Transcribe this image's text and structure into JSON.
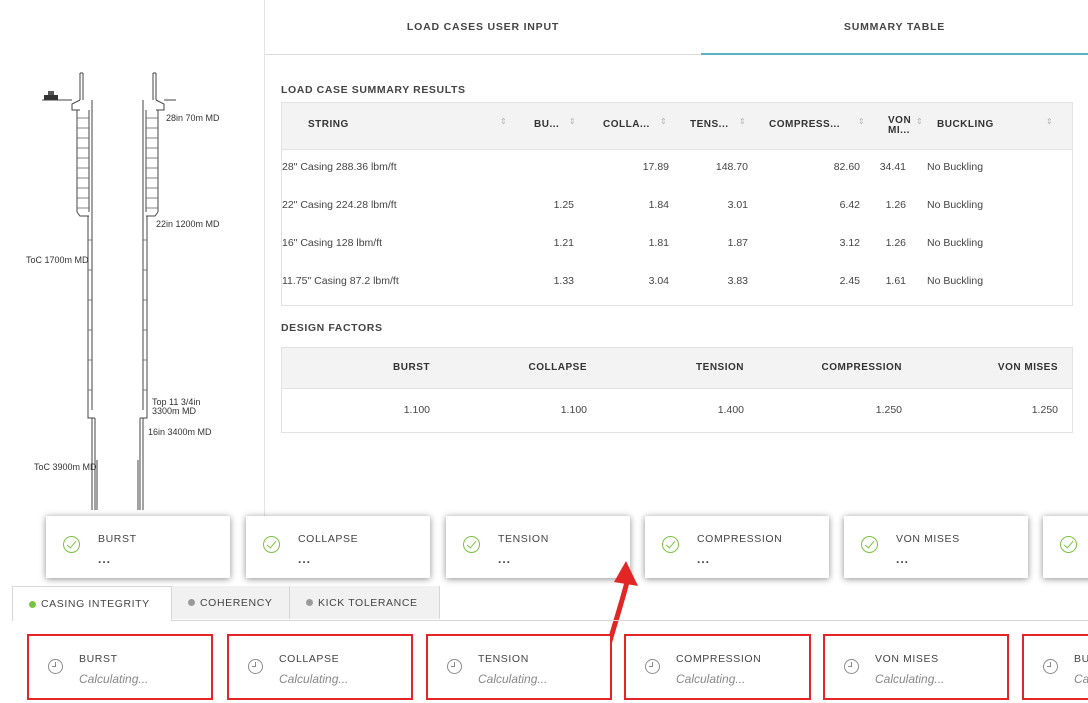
{
  "top_tabs": [
    "LOAD CASES USER INPUT",
    "SUMMARY TABLE"
  ],
  "wellbore": {
    "labels": {
      "l28": "28in 70m MD",
      "l22": "22in 1200m MD",
      "toc1": "ToC 1700m MD",
      "top1134": "Top 11 3/4in 3300m MD",
      "l16": "16in 3400m MD",
      "toc2": "ToC 3900m MD"
    }
  },
  "summary": {
    "title": "LOAD CASE SUMMARY RESULTS",
    "columns": [
      "STRING",
      "BU...",
      "COLLA...",
      "TENS...",
      "COMPRESS...",
      "VON MI...",
      "BUCKLING"
    ],
    "rows": [
      [
        "28\" Casing 288.36 lbm/ft",
        "",
        "17.89",
        "148.70",
        "82.60",
        "34.41",
        "No Buckling"
      ],
      [
        "22\" Casing 224.28 lbm/ft",
        "1.25",
        "1.84",
        "3.01",
        "6.42",
        "1.26",
        "No Buckling"
      ],
      [
        "16\" Casing 128 lbm/ft",
        "1.21",
        "1.81",
        "1.87",
        "3.12",
        "1.26",
        "No Buckling"
      ],
      [
        "11.75\" Casing 87.2 lbm/ft",
        "1.33",
        "3.04",
        "3.83",
        "2.45",
        "1.61",
        "No Buckling"
      ]
    ]
  },
  "design_factors": {
    "title": "DESIGN FACTORS",
    "columns": [
      "BURST",
      "COLLAPSE",
      "TENSION",
      "COMPRESSION",
      "VON MISES"
    ],
    "values": [
      "1.100",
      "1.100",
      "1.400",
      "1.250",
      "1.250"
    ]
  },
  "result_cards": [
    {
      "title": "BURST",
      "value": "..."
    },
    {
      "title": "COLLAPSE",
      "value": "..."
    },
    {
      "title": "TENSION",
      "value": "..."
    },
    {
      "title": "COMPRESSION",
      "value": "..."
    },
    {
      "title": "VON MISES",
      "value": "..."
    }
  ],
  "bottom_tabs": [
    {
      "label": "CASING INTEGRITY",
      "dot_color": "#7cc242"
    },
    {
      "label": "COHERENCY",
      "dot_color": "#9a9a9a"
    },
    {
      "label": "KICK TOLERANCE",
      "dot_color": "#9a9a9a"
    }
  ],
  "calc_cards": [
    {
      "title": "BURST",
      "status": "Calculating..."
    },
    {
      "title": "COLLAPSE",
      "status": "Calculating..."
    },
    {
      "title": "TENSION",
      "status": "Calculating..."
    },
    {
      "title": "COMPRESSION",
      "status": "Calculating..."
    },
    {
      "title": "VON MISES",
      "status": "Calculating..."
    },
    {
      "title": "BU",
      "status": "Ca"
    }
  ],
  "colors": {
    "accent": "#59b3c3",
    "ok": "#7cc242",
    "highlight": "#e22626"
  }
}
